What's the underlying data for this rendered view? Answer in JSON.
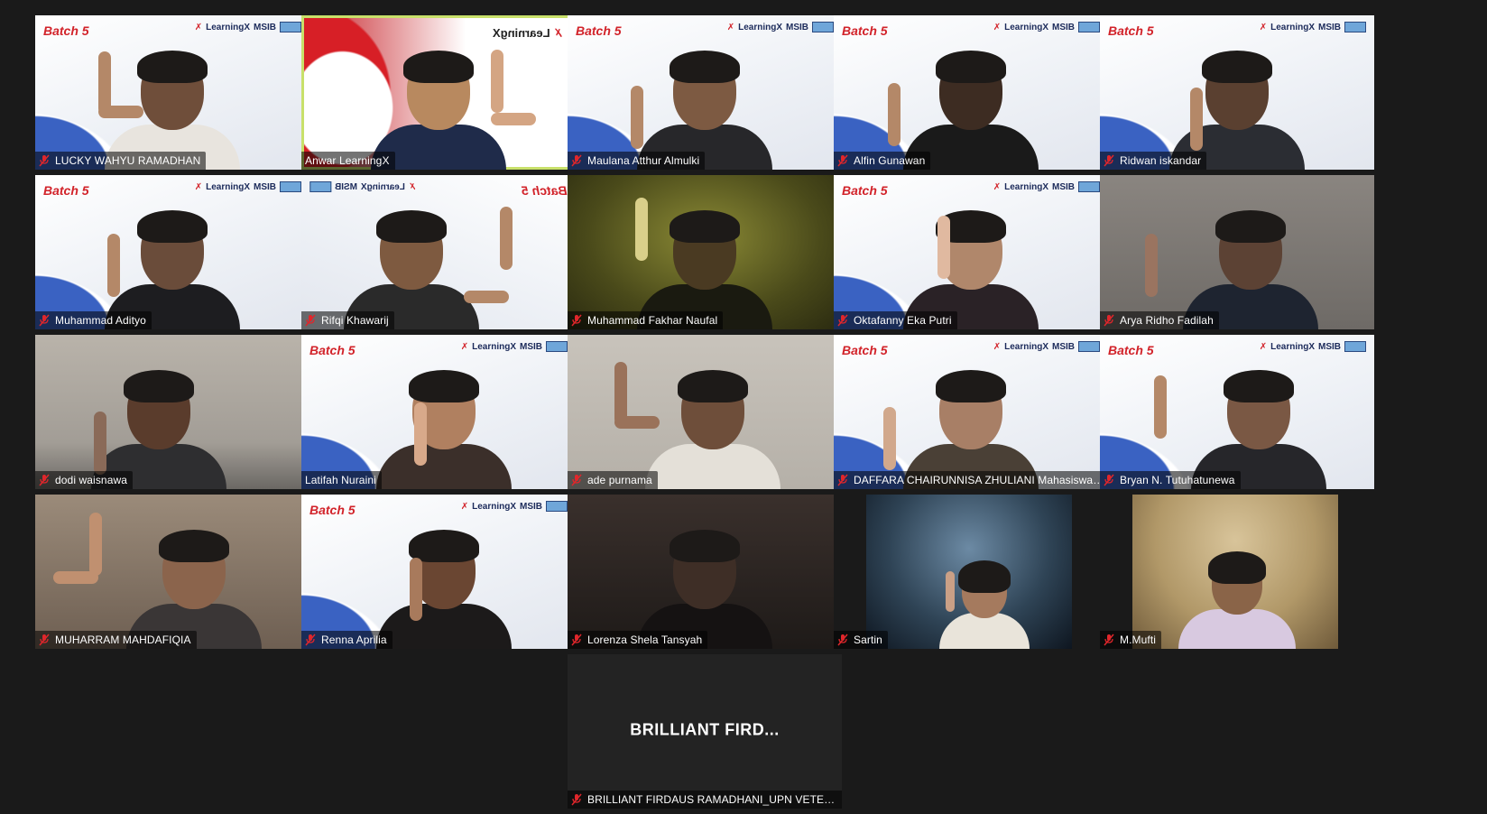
{
  "meeting": {
    "tiles": [
      {
        "name": "LUCKY WAHYU RAMADHAN",
        "bg": "branded",
        "muted": true
      },
      {
        "name": "Anwar LearningX",
        "bg": "red",
        "muted": false,
        "active": true
      },
      {
        "name": "Maulana Atthur Almulki",
        "bg": "branded",
        "muted": true
      },
      {
        "name": "Alfin Gunawan",
        "bg": "branded",
        "muted": true
      },
      {
        "name": "Ridwan iskandar",
        "bg": "branded",
        "muted": true
      },
      {
        "name": "Muhammad Adityo",
        "bg": "branded",
        "muted": true
      },
      {
        "name": "Rifqi Khawarij",
        "bg": "branded-mirror",
        "muted": true
      },
      {
        "name": "Muhammad Fakhar Naufal",
        "bg": "yellowdark",
        "muted": true
      },
      {
        "name": "Oktafanny Eka Putri",
        "bg": "branded",
        "muted": true
      },
      {
        "name": "Arya Ridho Fadilah",
        "bg": "grey",
        "muted": true
      },
      {
        "name": "dodi waisnawa",
        "bg": "room",
        "muted": true
      },
      {
        "name": "Latifah Nuraini",
        "bg": "branded",
        "muted": true
      },
      {
        "name": "ade purnama",
        "bg": "light",
        "muted": true
      },
      {
        "name": "DAFFARA CHAIRUNNISA ZHULIANI Mahasiswa ...",
        "bg": "branded",
        "muted": true
      },
      {
        "name": "Bryan N. Tutuhatunewa",
        "bg": "branded",
        "muted": true
      },
      {
        "name": "MUHARRAM MAHDAFIQIA",
        "bg": "warm",
        "muted": true
      },
      {
        "name": "Renna Aprilia",
        "bg": "branded",
        "muted": true
      },
      {
        "name": "Lorenza Shela Tansyah",
        "bg": "dark",
        "muted": true
      },
      {
        "name": "Sartin",
        "bg": "blackblue",
        "muted": true
      },
      {
        "name": "M.Mufti",
        "bg": "yellowroom",
        "muted": true
      },
      {
        "name": "BRILLIANT FIRDAUS RAMADHANI_UPN VETER...",
        "bg": "empty",
        "muted": true,
        "center_label": "BRILLIANT  FIRD..."
      }
    ],
    "overlay": {
      "batch_label": "Batch 5",
      "brand_learningx": "LearningX",
      "brand_msib": "MSIB",
      "red_brand": "LearningX"
    },
    "colors": {
      "active_border": "#c8e06a",
      "mute_red": "#e0262b",
      "background": "#1a1a1a"
    }
  }
}
